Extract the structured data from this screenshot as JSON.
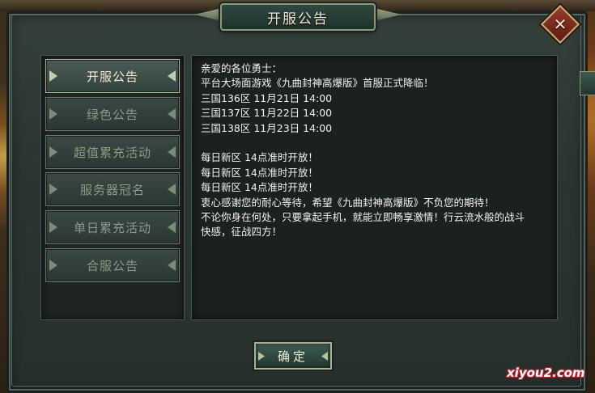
{
  "dialog": {
    "title": "开服公告",
    "close_icon": "close-icon",
    "close_label": "✕"
  },
  "menu": {
    "items": [
      {
        "label": "开服公告",
        "active": true
      },
      {
        "label": "绿色公告",
        "active": false
      },
      {
        "label": "超值累充活动",
        "active": false
      },
      {
        "label": "服务器冠名",
        "active": false
      },
      {
        "label": "单日累充活动",
        "active": false
      },
      {
        "label": "合服公告",
        "active": false
      }
    ]
  },
  "content": {
    "lines": [
      "亲爱的各位勇士：",
      "平台大场面游戏《九曲封神高爆版》首服正式降临！",
      "三国136区 11月21日 14:00",
      "三国137区 11月22日 14:00",
      "三国138区 11月23日 14:00",
      "",
      "每日新区 14点准时开放！",
      "每日新区 14点准时开放！",
      "每日新区 14点准时开放！",
      "衷心感谢您的耐心等待，希望《九曲封神高爆版》不负您的期待！",
      "不论你身在何处，只要拿起手机，就能立即畅享激情！行云流水般的战斗",
      "快感，征战四方！"
    ]
  },
  "footer": {
    "confirm_label": "确定"
  },
  "watermark": {
    "text": "xiyou2.com"
  },
  "colors": {
    "active_text": "#f3ecd6",
    "inactive_text": "#8b9a8a",
    "content_text": "#f2f2ee",
    "panel_bg": "#1b211f"
  }
}
